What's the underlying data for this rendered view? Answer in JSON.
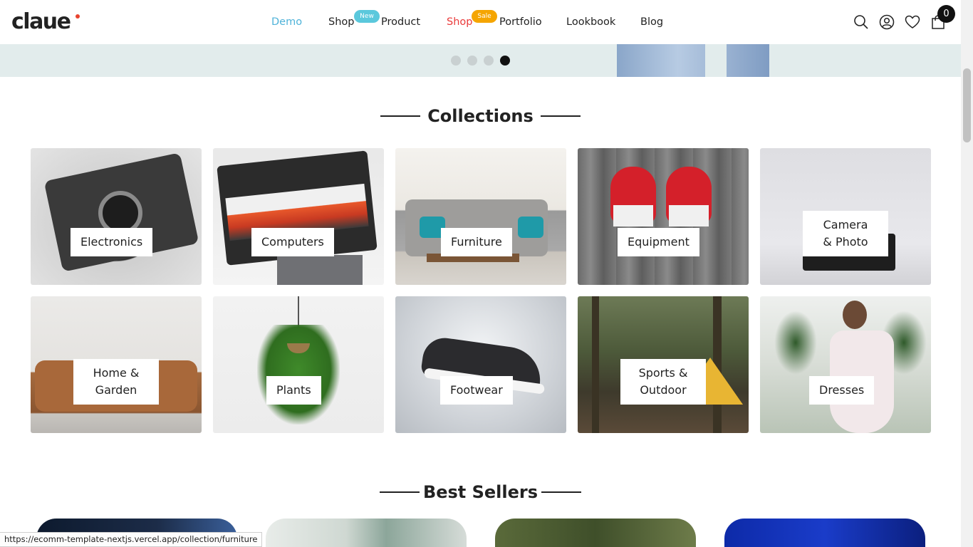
{
  "brand": {
    "logo_text": "claue",
    "accent": "#e8432f"
  },
  "nav": {
    "items": [
      {
        "label": "Demo",
        "state": "active"
      },
      {
        "label": "Shop",
        "badge": "New",
        "badge_color": "#5bc8dc"
      },
      {
        "label": "Product"
      },
      {
        "label": "Shop",
        "badge": "Sale",
        "badge_color": "#f5a500",
        "state": "sale"
      },
      {
        "label": "Portfolio"
      },
      {
        "label": "Lookbook"
      },
      {
        "label": "Blog"
      }
    ],
    "icons": [
      "search-icon",
      "user-icon",
      "heart-icon",
      "cart-icon"
    ],
    "cart_count": "0"
  },
  "hero": {
    "slides_total": 4,
    "active_slide": 4
  },
  "collections": {
    "title": "Collections",
    "tiles": [
      {
        "label": "Electronics"
      },
      {
        "label": "Computers"
      },
      {
        "label": "Furniture"
      },
      {
        "label": "Equipment"
      },
      {
        "label": "Camera & Photo",
        "lines": [
          "Camera",
          "& Photo"
        ]
      },
      {
        "label": "Home & Garden",
        "lines": [
          "Home &",
          "Garden"
        ]
      },
      {
        "label": "Plants"
      },
      {
        "label": "Footwear"
      },
      {
        "label": "Sports & Outdoor",
        "lines": [
          "Sports &",
          "Outdoor"
        ]
      },
      {
        "label": "Dresses"
      }
    ]
  },
  "best_sellers": {
    "title": "Best Sellers"
  },
  "status_bar": {
    "url": "https://ecomm-template-nextjs.vercel.app/collection/furniture"
  }
}
